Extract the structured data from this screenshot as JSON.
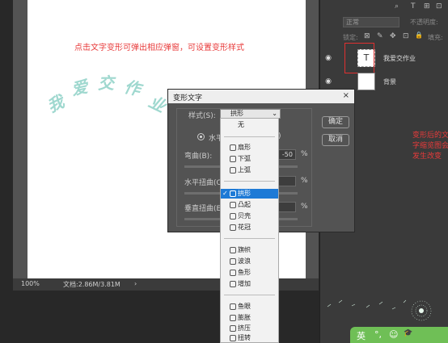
{
  "canvas": {
    "annotation": "点击文字变形可弹出相应弹窗，可设置变形样式",
    "warped_text": [
      "我",
      "爱",
      "交",
      "作",
      "业"
    ]
  },
  "status_bar": {
    "zoom": "100%",
    "doc_info": "文档:2.86M/3.81M",
    "arrow": "›"
  },
  "layers_panel": {
    "mode_label": "正常",
    "opacity_label": "不透明度:",
    "lock_label": "锁定:",
    "fill_label": "填充:",
    "top_tools": [
      "⌕",
      "T",
      "⊞",
      "⊡"
    ],
    "lock_icons": [
      "⊠",
      "✎",
      "✥",
      "⊡",
      "🔒"
    ],
    "layers": [
      {
        "thumb_glyph": "T",
        "name": "我爱交作业"
      },
      {
        "thumb_glyph": "",
        "name": "背景"
      }
    ],
    "annotation": "变形后的文字缩览图会发生改变"
  },
  "warp_dialog": {
    "title": "变形文字",
    "close": "×",
    "style_label": "样式(S):",
    "style_value": "拱形",
    "orientation_h": "水平",
    "orientation_v": ")",
    "bend_label": "弯曲(B):",
    "bend_value": "-50",
    "h_distort_label": "水平扭曲(O",
    "h_distort_value": "",
    "v_distort_label": "垂直扭曲(E",
    "v_distort_value": "",
    "percent": "%",
    "ok_button": "确定",
    "cancel_button": "取消"
  },
  "style_dropdown": {
    "selected_check": "✓",
    "items": [
      {
        "label": "无"
      },
      {
        "label": "扇形"
      },
      {
        "label": "下弧"
      },
      {
        "label": "上弧"
      },
      {
        "label": "拱形",
        "selected": true
      },
      {
        "label": "凸起"
      },
      {
        "label": "贝壳"
      },
      {
        "label": "花冠"
      },
      {
        "label": "旗帜"
      },
      {
        "label": "波浪"
      },
      {
        "label": "鱼形"
      },
      {
        "label": "增加"
      },
      {
        "label": "鱼眼"
      },
      {
        "label": "膨胀"
      },
      {
        "label": "挤压"
      },
      {
        "label": "扭转"
      }
    ]
  },
  "taskbar": {
    "ime": [
      "英",
      "°,",
      "☺",
      "🎓"
    ]
  }
}
